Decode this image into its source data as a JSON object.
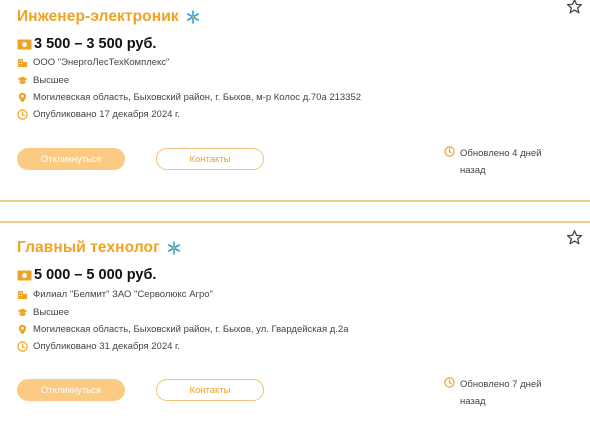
{
  "vacancies": [
    {
      "title": "Инженер-электроник",
      "salary": "3 500 – 3 500 руб.",
      "company": "ООО \"ЭнергоЛесТехКомплекс\"",
      "education": "Высшее",
      "address": "Могилевская область, Быховский район, г. Быхов, м-р Колос д.70а 213352",
      "published": "Опубликовано 17 декабря 2024 г.",
      "apply_label": "Откликнуться",
      "contacts_label": "Контакты",
      "updated_line1": "Обновлено 4 дней",
      "updated_line2": "назад"
    },
    {
      "title": "Главный технолог",
      "salary": "5 000 – 5 000 руб.",
      "company": "Филиал \"Белмит\" ЗАО \"Серволюкс Агро\"",
      "education": "Высшее",
      "address": "Могилевская область, Быховский район, г. Быхов, ул. Гвардейская д.2а",
      "published": "Опубликовано 31 декабря 2024 г.",
      "apply_label": "Откликнуться",
      "contacts_label": "Контакты",
      "updated_line1": "Обновлено 7 дней",
      "updated_line2": "назад"
    }
  ],
  "icons": {
    "badge": "snowflake-icon",
    "favorite": "star-icon",
    "salary": "money-icon",
    "company": "building-icon",
    "education": "graduation-cap-icon",
    "address": "location-pin-icon",
    "published": "clock-icon"
  },
  "colors": {
    "accent": "#f0a223",
    "button_fill": "#fbcb83",
    "divider": "#f6cf86",
    "badge": "#2aa0d8"
  }
}
